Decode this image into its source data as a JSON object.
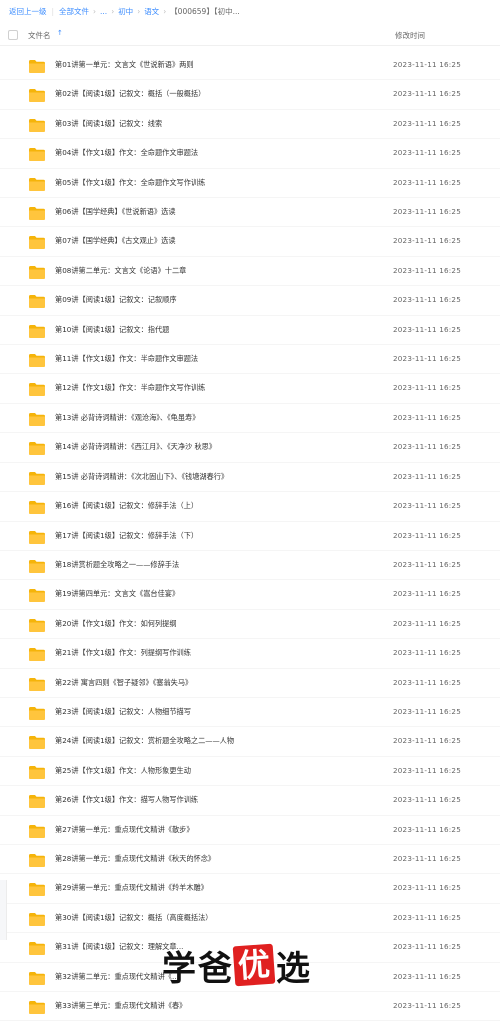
{
  "breadcrumb": {
    "back": "返回上一级",
    "all_files": "全部文件",
    "ellipsis": "...",
    "level1": "初中",
    "level2": "语文",
    "current": "【000659】【初中..."
  },
  "header": {
    "name": "文件名",
    "time": "修改时间"
  },
  "files": [
    {
      "name": "第01讲第一单元：文言文《世说新语》两则",
      "time": "2023-11-11 16:25"
    },
    {
      "name": "第02讲【阅读1级】记叙文：概括（一般概括）",
      "time": "2023-11-11 16:25"
    },
    {
      "name": "第03讲【阅读1级】记叙文：线索",
      "time": "2023-11-11 16:25"
    },
    {
      "name": "第04讲【作文1级】作文：全命题作文审题法",
      "time": "2023-11-11 16:25"
    },
    {
      "name": "第05讲【作文1级】作文：全命题作文写作训练",
      "time": "2023-11-11 16:25"
    },
    {
      "name": "第06讲【国学经典】《世说新语》选读",
      "time": "2023-11-11 16:25"
    },
    {
      "name": "第07讲【国学经典】《古文观止》选读",
      "time": "2023-11-11 16:25"
    },
    {
      "name": "第08讲第二单元：文言文《论语》十二章",
      "time": "2023-11-11 16:25"
    },
    {
      "name": "第09讲【阅读1级】记叙文：记叙顺序",
      "time": "2023-11-11 16:25"
    },
    {
      "name": "第10讲【阅读1级】记叙文：指代题",
      "time": "2023-11-11 16:25"
    },
    {
      "name": "第11讲【作文1级】作文：半命题作文审题法",
      "time": "2023-11-11 16:25"
    },
    {
      "name": "第12讲【作文1级】作文：半命题作文写作训练",
      "time": "2023-11-11 16:25"
    },
    {
      "name": "第13讲 必背诗词精讲：《观沧海》、《龟虽寿》",
      "time": "2023-11-11 16:25"
    },
    {
      "name": "第14讲 必背诗词精讲：《西江月》、《天净沙 秋思》",
      "time": "2023-11-11 16:25"
    },
    {
      "name": "第15讲 必背诗词精讲：《次北固山下》、《钱塘湖春行》",
      "time": "2023-11-11 16:25"
    },
    {
      "name": "第16讲【阅读1级】记叙文：修辞手法（上）",
      "time": "2023-11-11 16:25"
    },
    {
      "name": "第17讲【阅读1级】记叙文：修辞手法（下）",
      "time": "2023-11-11 16:25"
    },
    {
      "name": "第18讲赏析题全攻略之一——修辞手法",
      "time": "2023-11-11 16:25"
    },
    {
      "name": "第19讲第四单元：文言文《嵩台佳宴》",
      "time": "2023-11-11 16:25"
    },
    {
      "name": "第20讲【作文1级】作文：如何列提纲",
      "time": "2023-11-11 16:25"
    },
    {
      "name": "第21讲【作文1级】作文：列提纲写作训练",
      "time": "2023-11-11 16:25"
    },
    {
      "name": "第22讲 寓言四则《智子疑邻》《塞翁失马》",
      "time": "2023-11-11 16:25"
    },
    {
      "name": "第23讲【阅读1级】记叙文：人物细节描写",
      "time": "2023-11-11 16:25"
    },
    {
      "name": "第24讲【阅读1级】记叙文：赏析题全攻略之二——人物",
      "time": "2023-11-11 16:25"
    },
    {
      "name": "第25讲【作文1级】作文：人物形象更生动",
      "time": "2023-11-11 16:25"
    },
    {
      "name": "第26讲【作文1级】作文：描写人物写作训练",
      "time": "2023-11-11 16:25"
    },
    {
      "name": "第27讲第一单元：重点现代文精讲《散步》",
      "time": "2023-11-11 16:25"
    },
    {
      "name": "第28讲第一单元：重点现代文精讲《秋天的怀念》",
      "time": "2023-11-11 16:25"
    },
    {
      "name": "第29讲第一单元：重点现代文精讲《羚羊木雕》",
      "time": "2023-11-11 16:25"
    },
    {
      "name": "第30讲【阅读1级】记叙文：概括（高度概括法）",
      "time": "2023-11-11 16:25"
    },
    {
      "name": "第31讲【阅读1级】记叙文：理解文章...",
      "time": "2023-11-11 16:25"
    },
    {
      "name": "第32讲第二单元：重点现代文精讲《...",
      "time": "2023-11-11 16:25"
    },
    {
      "name": "第33讲第三单元：重点现代文精讲《春》",
      "time": "2023-11-11 16:25"
    }
  ],
  "watermark": {
    "char1": "学",
    "char2": "爸",
    "char3": "优",
    "char4": "选"
  },
  "colors": {
    "link": "#3b8cff",
    "folder": "#ffc53d",
    "folder_tab": "#f5b40a",
    "watermark_seal": "#e02020"
  }
}
